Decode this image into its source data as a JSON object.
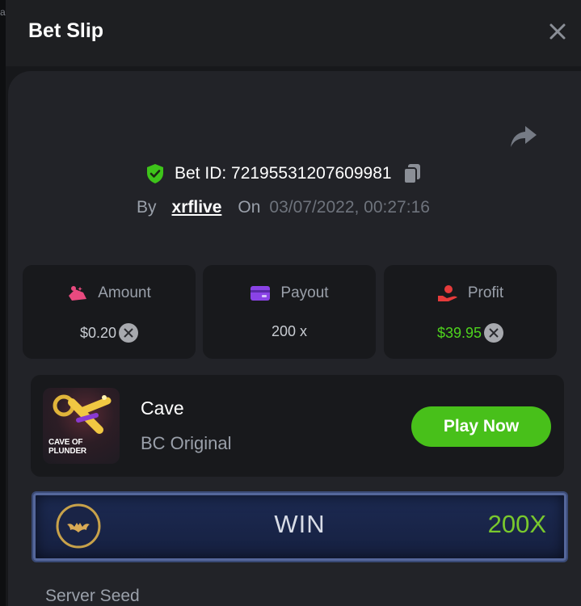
{
  "window": {
    "title": "Bet Slip",
    "left_strip_char": "a"
  },
  "bet": {
    "id_text": "Bet ID: 72195531207609981",
    "by_label": "By",
    "user": "xrflive",
    "on_label": "On",
    "datetime": "03/07/2022, 00:27:16"
  },
  "stats": [
    {
      "label": "Amount",
      "value": "$0.20",
      "icon": "amount-icon",
      "has_coin": true
    },
    {
      "label": "Payout",
      "value": "200 x",
      "icon": "wallet-icon",
      "has_coin": false
    },
    {
      "label": "Profit",
      "value": "$39.95",
      "icon": "profit-hand-icon",
      "has_coin": true
    }
  ],
  "game": {
    "name": "Cave",
    "subtitle": "BC Original",
    "thumbnail_text_line1": "CAVE OF",
    "thumbnail_text_line2": "PLUNDER",
    "play_label": "Play Now"
  },
  "result": {
    "label": "WIN",
    "multiplier": "200X"
  },
  "server_seed_label": "Server Seed",
  "colors": {
    "accent_green": "#48c01a",
    "profit_green": "#4ed31d",
    "amount_pink": "#e84a7f",
    "payout_purple": "#8a43e6",
    "profit_red": "#e63b3b",
    "shield_green": "#3ec41a"
  }
}
